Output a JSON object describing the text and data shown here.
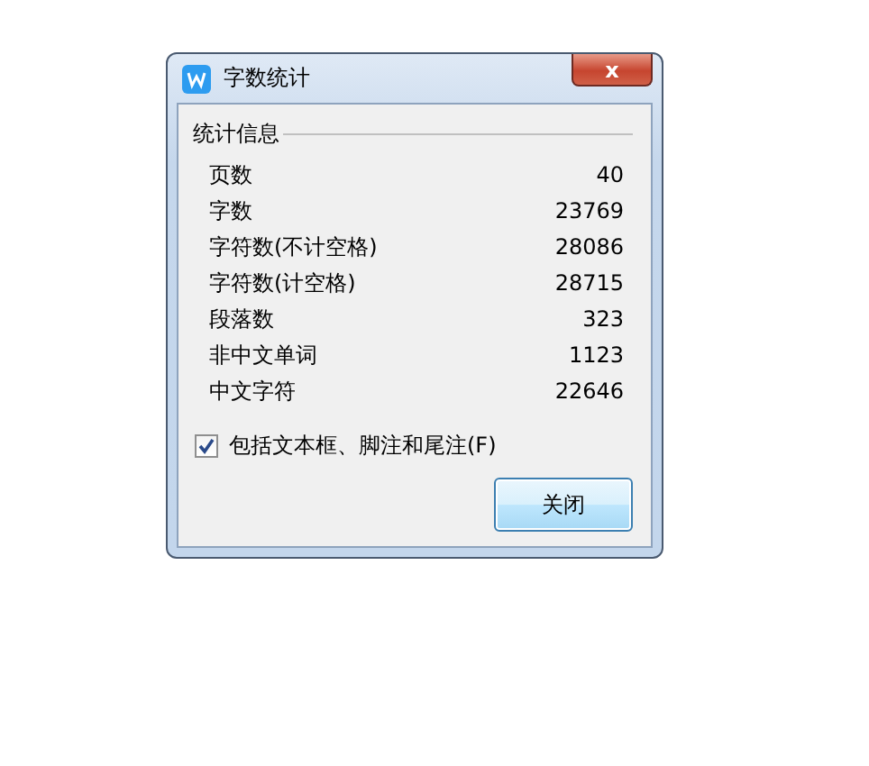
{
  "window": {
    "title": "字数统计",
    "close_label": "x"
  },
  "group": {
    "title": "统计信息"
  },
  "stats": [
    {
      "label": "页数",
      "value": "40"
    },
    {
      "label": "字数",
      "value": "23769"
    },
    {
      "label": "字符数(不计空格)",
      "value": "28086"
    },
    {
      "label": "字符数(计空格)",
      "value": "28715"
    },
    {
      "label": "段落数",
      "value": "323"
    },
    {
      "label": "非中文单词",
      "value": "1123"
    },
    {
      "label": "中文字符",
      "value": "22646"
    }
  ],
  "option": {
    "label": "包括文本框、脚注和尾注(F)",
    "checked": true
  },
  "buttons": [
    "关闭"
  ]
}
